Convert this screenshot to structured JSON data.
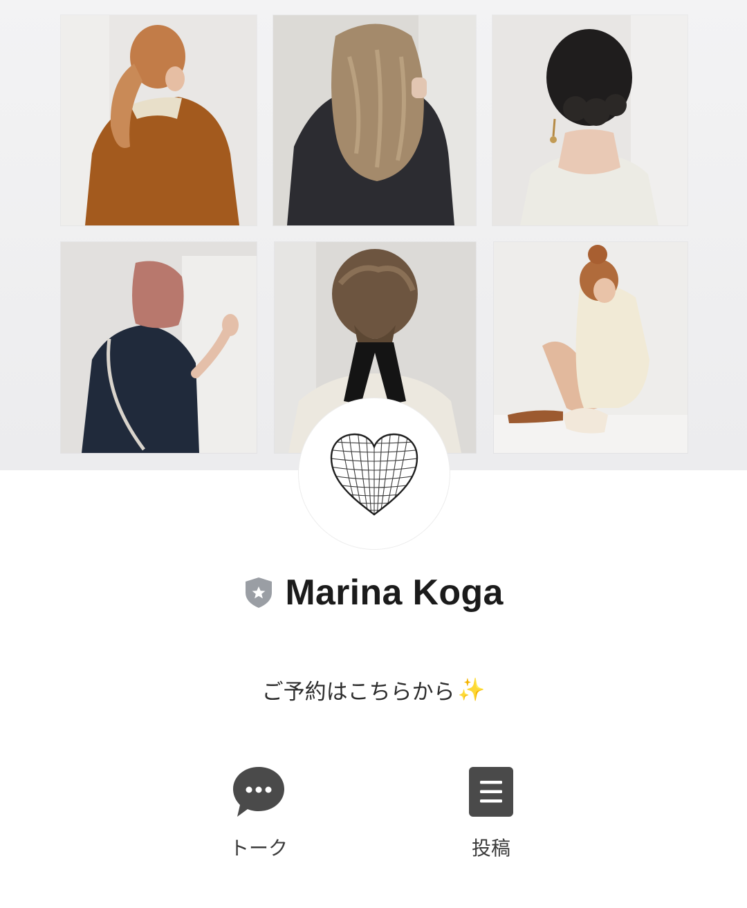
{
  "cover": {
    "photos": [
      {
        "name": "hair-photo-ponytail"
      },
      {
        "name": "hair-photo-long-waves"
      },
      {
        "name": "hair-photo-updo"
      },
      {
        "name": "hair-photo-bob"
      },
      {
        "name": "hair-photo-ribbon-braid"
      },
      {
        "name": "hair-photo-bun"
      }
    ]
  },
  "profile": {
    "avatar_icon": "wire-heart-icon",
    "badge_icon": "shield-star-icon",
    "name": "Marina Koga",
    "status_message": "ご予約はこちらから",
    "status_emoji": "✨"
  },
  "actions": {
    "talk": {
      "label": "トーク",
      "icon": "chat-bubble-icon"
    },
    "post": {
      "label": "投稿",
      "icon": "post-list-icon"
    }
  },
  "colors": {
    "icon_dark": "#4a4a4a",
    "badge": "#9a9ea4",
    "text": "#1b1b1b"
  }
}
